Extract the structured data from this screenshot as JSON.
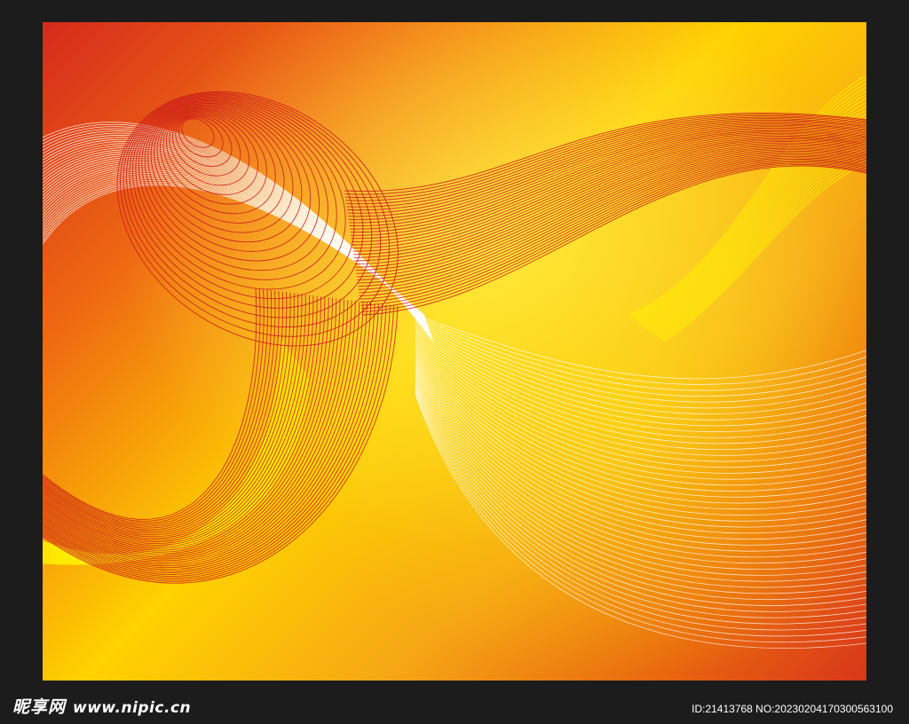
{
  "image": {
    "frame_color": "#1c1c1c",
    "gradient_colors": [
      "#d62a1c",
      "#ef6a12",
      "#ffd200",
      "#f6a515",
      "#e9660f",
      "#d8361a"
    ],
    "line_colors": {
      "red_lines": "#c8141a",
      "white_lines": "#ffffff",
      "yellow_lines": "#fff200"
    }
  },
  "watermark": {
    "site_name_cn": "昵享网",
    "site_url": "www.nipic.cn",
    "id_text": "ID:21413768 NO:20230204170300563100"
  }
}
